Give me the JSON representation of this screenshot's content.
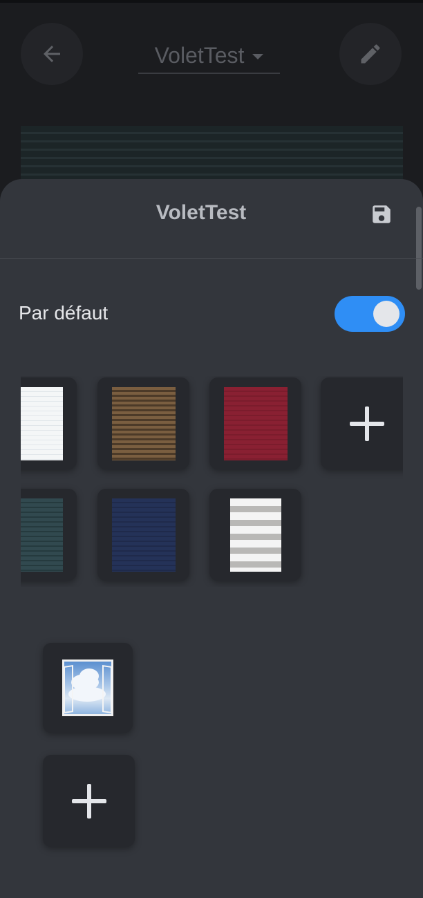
{
  "header": {
    "title": "VoletTest"
  },
  "sheet": {
    "title": "VoletTest",
    "default_label": "Par défaut",
    "default_enabled": true
  },
  "colors": {
    "accent": "#2f8ef5",
    "sheet_bg": "#33363c",
    "page_bg": "#1b1c1f"
  },
  "textures": [
    {
      "name": "white-blind"
    },
    {
      "name": "brown-blind"
    },
    {
      "name": "red-blind"
    },
    {
      "name": "teal-blind"
    },
    {
      "name": "navy-blind"
    },
    {
      "name": "striped-blind"
    }
  ],
  "icons": {
    "back": "arrow-left-icon",
    "edit": "pencil-icon",
    "dropdown": "caret-down-icon",
    "save": "floppy-disk-icon",
    "add": "plus-icon"
  }
}
